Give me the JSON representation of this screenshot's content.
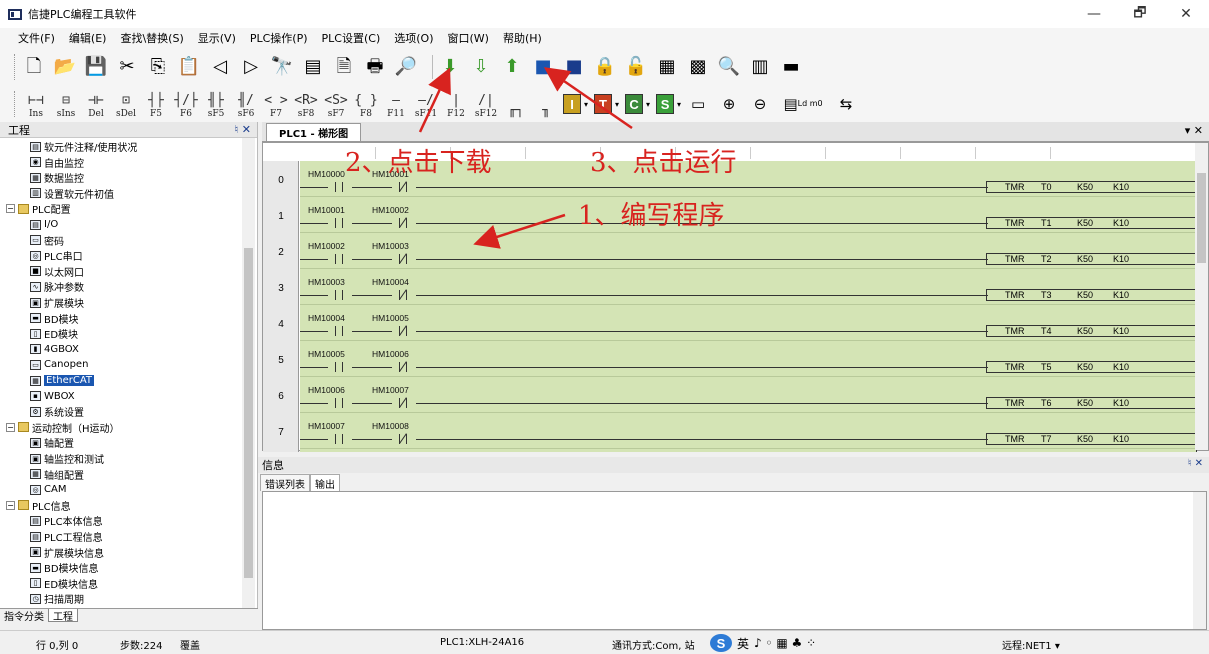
{
  "window": {
    "title": "信捷PLC编程工具软件",
    "controls": {
      "minimize": "—",
      "maximize": "🗗",
      "close": "✕"
    }
  },
  "menu": [
    "文件(F)",
    "编辑(E)",
    "查找\\替换(S)",
    "显示(V)",
    "PLC操作(P)",
    "PLC设置(C)",
    "选项(O)",
    "窗口(W)",
    "帮助(H)"
  ],
  "toolbar_row1": [
    {
      "icon": "new-file-icon",
      "glyph": "🗋"
    },
    {
      "icon": "open-folder-icon",
      "glyph": "📂"
    },
    {
      "icon": "save-icon",
      "glyph": "💾"
    },
    {
      "icon": "cut-icon",
      "glyph": "✂"
    },
    {
      "icon": "copy-icon",
      "glyph": "⎘"
    },
    {
      "icon": "paste-icon",
      "glyph": "📋"
    },
    {
      "icon": "back-icon",
      "glyph": "◁"
    },
    {
      "icon": "forward-icon",
      "glyph": "▷"
    },
    {
      "icon": "find-icon",
      "glyph": "🔭"
    },
    {
      "icon": "list-icon",
      "glyph": "▤"
    },
    {
      "icon": "document-icon",
      "glyph": "🗎"
    },
    {
      "icon": "print-icon",
      "glyph": "🖶"
    },
    {
      "icon": "help-icon",
      "glyph": "🔎"
    },
    {
      "icon": "download-icon",
      "glyph": "⬇",
      "color": "#3a9a2a"
    },
    {
      "icon": "upload-download-icon",
      "glyph": "⇩",
      "color": "#3a9a2a"
    },
    {
      "icon": "upload-icon",
      "glyph": "⬆",
      "color": "#3a9a2a"
    },
    {
      "icon": "run-icon",
      "glyph": "■",
      "color": "#1a56b0"
    },
    {
      "icon": "stop-icon",
      "glyph": "■",
      "color": "#1a3c8c"
    },
    {
      "icon": "lock-icon",
      "glyph": "🔒"
    },
    {
      "icon": "unlock-icon",
      "glyph": "🔓"
    },
    {
      "icon": "monitor-icon",
      "glyph": "▦"
    },
    {
      "icon": "online-edit-icon",
      "glyph": "▩"
    },
    {
      "icon": "compare-icon",
      "glyph": "🔍"
    },
    {
      "icon": "config-icon",
      "glyph": "▥"
    },
    {
      "icon": "port-icon",
      "glyph": "▬"
    }
  ],
  "toolbar_row2": [
    {
      "icon": "insert-icon",
      "glyph": "⊢⊣",
      "label": "Ins"
    },
    {
      "icon": "insert-line-icon",
      "glyph": "⊟",
      "label": "sIns"
    },
    {
      "icon": "delete-icon",
      "glyph": "⊣⊢",
      "label": "Del"
    },
    {
      "icon": "delete-line-icon",
      "glyph": "⊡",
      "label": "sDel"
    },
    {
      "icon": "no-contact-icon",
      "glyph": "┤├",
      "label": "F5"
    },
    {
      "icon": "nc-contact-icon",
      "glyph": "┤/├",
      "label": "F6"
    },
    {
      "icon": "parallel-no-icon",
      "glyph": "╢├",
      "label": "sF5"
    },
    {
      "icon": "parallel-nc-icon",
      "glyph": "╢/",
      "label": "sF6"
    },
    {
      "icon": "coil-icon",
      "glyph": "< >",
      "label": "F7"
    },
    {
      "icon": "reset-coil-icon",
      "glyph": "<R>",
      "label": "sF8"
    },
    {
      "icon": "set-coil-icon",
      "glyph": "<S>",
      "label": "sF7"
    },
    {
      "icon": "instruction-icon",
      "glyph": "{ }",
      "label": "F8"
    },
    {
      "icon": "hline-icon",
      "glyph": "—",
      "label": "F11"
    },
    {
      "icon": "delete-hline-icon",
      "glyph": "—/",
      "label": "sF11"
    },
    {
      "icon": "vline-icon",
      "glyph": "|",
      "label": "F12"
    },
    {
      "icon": "delete-vline-icon",
      "glyph": "/|",
      "label": "sF12"
    },
    {
      "icon": "block-icon",
      "glyph": "╓┐",
      "label": ""
    },
    {
      "icon": "block-edit-icon",
      "glyph": "╖",
      "label": ""
    }
  ],
  "toolbar_colors": [
    {
      "icon": "i-register-icon",
      "letter": "I",
      "color": "#c8a020"
    },
    {
      "icon": "t-register-icon",
      "letter": "T",
      "color": "#c84020"
    },
    {
      "icon": "c-register-icon",
      "letter": "C",
      "color": "#3a8a3a"
    },
    {
      "icon": "s-register-icon",
      "letter": "S",
      "color": "#3aa03a"
    }
  ],
  "toolbar_row2_tail": [
    {
      "icon": "block-window-icon",
      "glyph": "▭"
    },
    {
      "icon": "zoom-in-icon",
      "glyph": "⊕"
    },
    {
      "icon": "zoom-out-icon",
      "glyph": "⊖"
    },
    {
      "icon": "ld-instruction-icon",
      "glyph": "▤",
      "label": "Ld m0"
    },
    {
      "icon": "transfer-icon",
      "glyph": "⇆"
    }
  ],
  "left_panel": {
    "title": "工程",
    "pin": "♮ ✕",
    "tree": [
      {
        "level": 2,
        "icon": "▤",
        "label": "软元件注释/使用状况"
      },
      {
        "level": 2,
        "icon": "◉",
        "label": "自由监控"
      },
      {
        "level": 2,
        "icon": "▦",
        "label": "数据监控"
      },
      {
        "level": 2,
        "icon": "▥",
        "label": "设置软元件初值"
      },
      {
        "level": 1,
        "icon": "folder",
        "label": "PLC配置",
        "expander": "−"
      },
      {
        "level": 2,
        "icon": "▤",
        "label": "I/O"
      },
      {
        "level": 2,
        "icon": "▭",
        "label": "密码"
      },
      {
        "level": 2,
        "icon": "◎",
        "label": "PLC串口"
      },
      {
        "level": 2,
        "icon": "■",
        "label": "以太网口"
      },
      {
        "level": 2,
        "icon": "∿",
        "label": "脉冲参数"
      },
      {
        "level": 2,
        "icon": "▣",
        "label": "扩展模块"
      },
      {
        "level": 2,
        "icon": "▬",
        "label": "BD模块"
      },
      {
        "level": 2,
        "icon": "▯",
        "label": "ED模块"
      },
      {
        "level": 2,
        "icon": "▮",
        "label": "4GBOX"
      },
      {
        "level": 2,
        "icon": "▭",
        "label": "Canopen"
      },
      {
        "level": 2,
        "icon": "▦",
        "label": "EtherCAT",
        "selected": true
      },
      {
        "level": 2,
        "icon": "▪",
        "label": "WBOX"
      },
      {
        "level": 2,
        "icon": "⚙",
        "label": "系统设置"
      },
      {
        "level": 1,
        "icon": "folder",
        "label": "运动控制（H运动）",
        "expander": "−"
      },
      {
        "level": 2,
        "icon": "▣",
        "label": "轴配置"
      },
      {
        "level": 2,
        "icon": "▣",
        "label": "轴监控和测试"
      },
      {
        "level": 2,
        "icon": "▦",
        "label": "轴组配置"
      },
      {
        "level": 2,
        "icon": "◎",
        "label": "CAM"
      },
      {
        "level": 1,
        "icon": "folder",
        "label": "PLC信息",
        "expander": "−"
      },
      {
        "level": 2,
        "icon": "▤",
        "label": "PLC本体信息"
      },
      {
        "level": 2,
        "icon": "▤",
        "label": "PLC工程信息"
      },
      {
        "level": 2,
        "icon": "▣",
        "label": "扩展模块信息"
      },
      {
        "level": 2,
        "icon": "▬",
        "label": "BD模块信息"
      },
      {
        "level": 2,
        "icon": "▯",
        "label": "ED模块信息"
      },
      {
        "level": 2,
        "icon": "◷",
        "label": "扫描周期"
      }
    ],
    "bottom_tabs": [
      "指令分类",
      "工程"
    ]
  },
  "document": {
    "tab_label": "PLC1 - 梯形图",
    "close": "▾ ✕",
    "rungs": [
      {
        "num": "0",
        "c1": "HM10000",
        "c2": "HM10001",
        "coil": {
          "op": "TMR",
          "reg": "T0",
          "k1": "K50",
          "k2": "K10"
        }
      },
      {
        "num": "1",
        "c1": "HM10001",
        "c2": "HM10002",
        "coil": {
          "op": "TMR",
          "reg": "T1",
          "k1": "K50",
          "k2": "K10"
        }
      },
      {
        "num": "2",
        "c1": "HM10002",
        "c2": "HM10003",
        "coil": {
          "op": "TMR",
          "reg": "T2",
          "k1": "K50",
          "k2": "K10"
        }
      },
      {
        "num": "3",
        "c1": "HM10003",
        "c2": "HM10004",
        "coil": {
          "op": "TMR",
          "reg": "T3",
          "k1": "K50",
          "k2": "K10"
        }
      },
      {
        "num": "4",
        "c1": "HM10004",
        "c2": "HM10005",
        "coil": {
          "op": "TMR",
          "reg": "T4",
          "k1": "K50",
          "k2": "K10"
        }
      },
      {
        "num": "5",
        "c1": "HM10005",
        "c2": "HM10006",
        "coil": {
          "op": "TMR",
          "reg": "T5",
          "k1": "K50",
          "k2": "K10"
        }
      },
      {
        "num": "6",
        "c1": "HM10006",
        "c2": "HM10007",
        "coil": {
          "op": "TMR",
          "reg": "T6",
          "k1": "K50",
          "k2": "K10"
        }
      },
      {
        "num": "7",
        "c1": "HM10007",
        "c2": "HM10008",
        "coil": {
          "op": "TMR",
          "reg": "T7",
          "k1": "K50",
          "k2": "K10"
        }
      }
    ]
  },
  "info_panel": {
    "title": "信息",
    "pin": "♮ ✕",
    "tabs": [
      "错误列表",
      "输出"
    ]
  },
  "statusbar": {
    "position": "行 0,列 0",
    "steps": "步数:224",
    "mode": "覆盖",
    "plc": "PLC1:XLH-24A16",
    "comm": "通讯方式:Com, 站",
    "ime": {
      "logo": "S",
      "lang": "英",
      "extra": "♪ ◦ ▦ ♣ ⁘"
    },
    "remote": "远程:NET1 ▾"
  },
  "annotations": {
    "step1": "1、编写程序",
    "step2": "2、点击下载",
    "step3": "3、点击运行",
    "color": "#d8231f"
  }
}
